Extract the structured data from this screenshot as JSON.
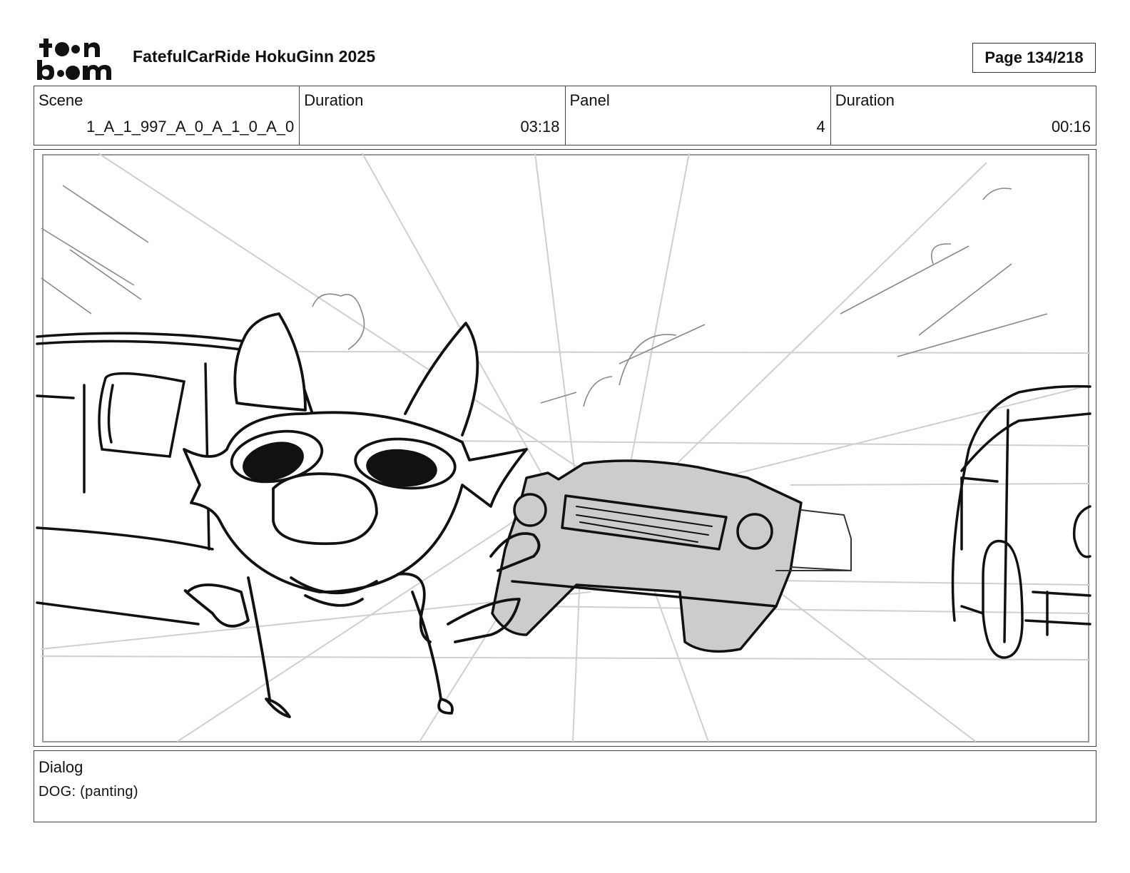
{
  "header": {
    "logo_text": "toonboom",
    "title": "FatefulCarRide HokuGinn 2025",
    "page": "Page 134/218"
  },
  "info": {
    "scene_label": "Scene",
    "scene_value": "1_A_1_997_A_0_A_1_0_A_0",
    "scene_duration_label": "Duration",
    "scene_duration_value": "03:18",
    "panel_label": "Panel",
    "panel_value": "4",
    "panel_duration_label": "Duration",
    "panel_duration_value": "00:16"
  },
  "panel_image": {
    "icon": "storyboard-sketch-dog-and-cars"
  },
  "dialog": {
    "label": "Dialog",
    "text": "DOG: (panting)"
  }
}
